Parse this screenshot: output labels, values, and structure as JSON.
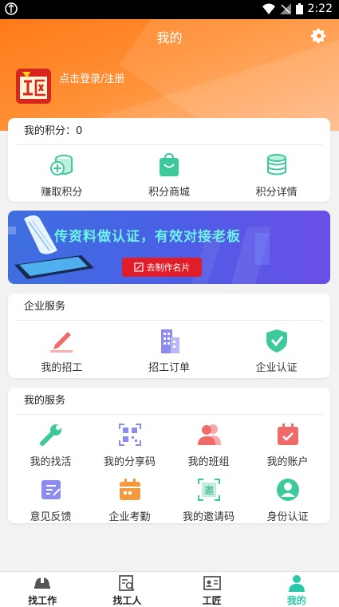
{
  "status_bar": {
    "time": "2:22"
  },
  "header": {
    "title": "我的",
    "login_text": "点击登录/注册",
    "avatar_text": "工匠"
  },
  "points": {
    "title": "我的积分：0",
    "items": [
      {
        "label": "赚取积分",
        "icon": "earn-points-icon"
      },
      {
        "label": "积分商城",
        "icon": "points-mall-icon"
      },
      {
        "label": "积分详情",
        "icon": "points-detail-icon"
      }
    ]
  },
  "banner": {
    "headline": "传资料做认证，有效对接老板",
    "button": "去制作名片"
  },
  "enterprise": {
    "title": "企业服务",
    "items": [
      {
        "label": "我的招工",
        "icon": "pen-icon"
      },
      {
        "label": "招工订单",
        "icon": "building-icon"
      },
      {
        "label": "企业认证",
        "icon": "shield-check-icon"
      }
    ]
  },
  "services": {
    "title": "我的服务",
    "items": [
      {
        "label": "我的找活",
        "icon": "wrench-icon"
      },
      {
        "label": "我的分享码",
        "icon": "qr-code-icon"
      },
      {
        "label": "我的班组",
        "icon": "team-icon"
      },
      {
        "label": "我的账户",
        "icon": "calendar-check-icon"
      },
      {
        "label": "意见反馈",
        "icon": "feedback-icon"
      },
      {
        "label": "企业考勤",
        "icon": "attendance-icon"
      },
      {
        "label": "我的邀请码",
        "icon": "invite-code-icon"
      },
      {
        "label": "身份认证",
        "icon": "id-verify-icon"
      }
    ]
  },
  "tabbar": {
    "items": [
      {
        "label": "找工作",
        "icon": "helmet-icon"
      },
      {
        "label": "找工人",
        "icon": "find-worker-icon"
      },
      {
        "label": "工匠",
        "icon": "id-card-icon"
      },
      {
        "label": "我的",
        "icon": "person-icon"
      }
    ],
    "active_index": 3
  },
  "colors": {
    "header_orange": "#ff7a1a",
    "accent_teal": "#28c8a8",
    "banner_button_red": "#e21d2a"
  }
}
